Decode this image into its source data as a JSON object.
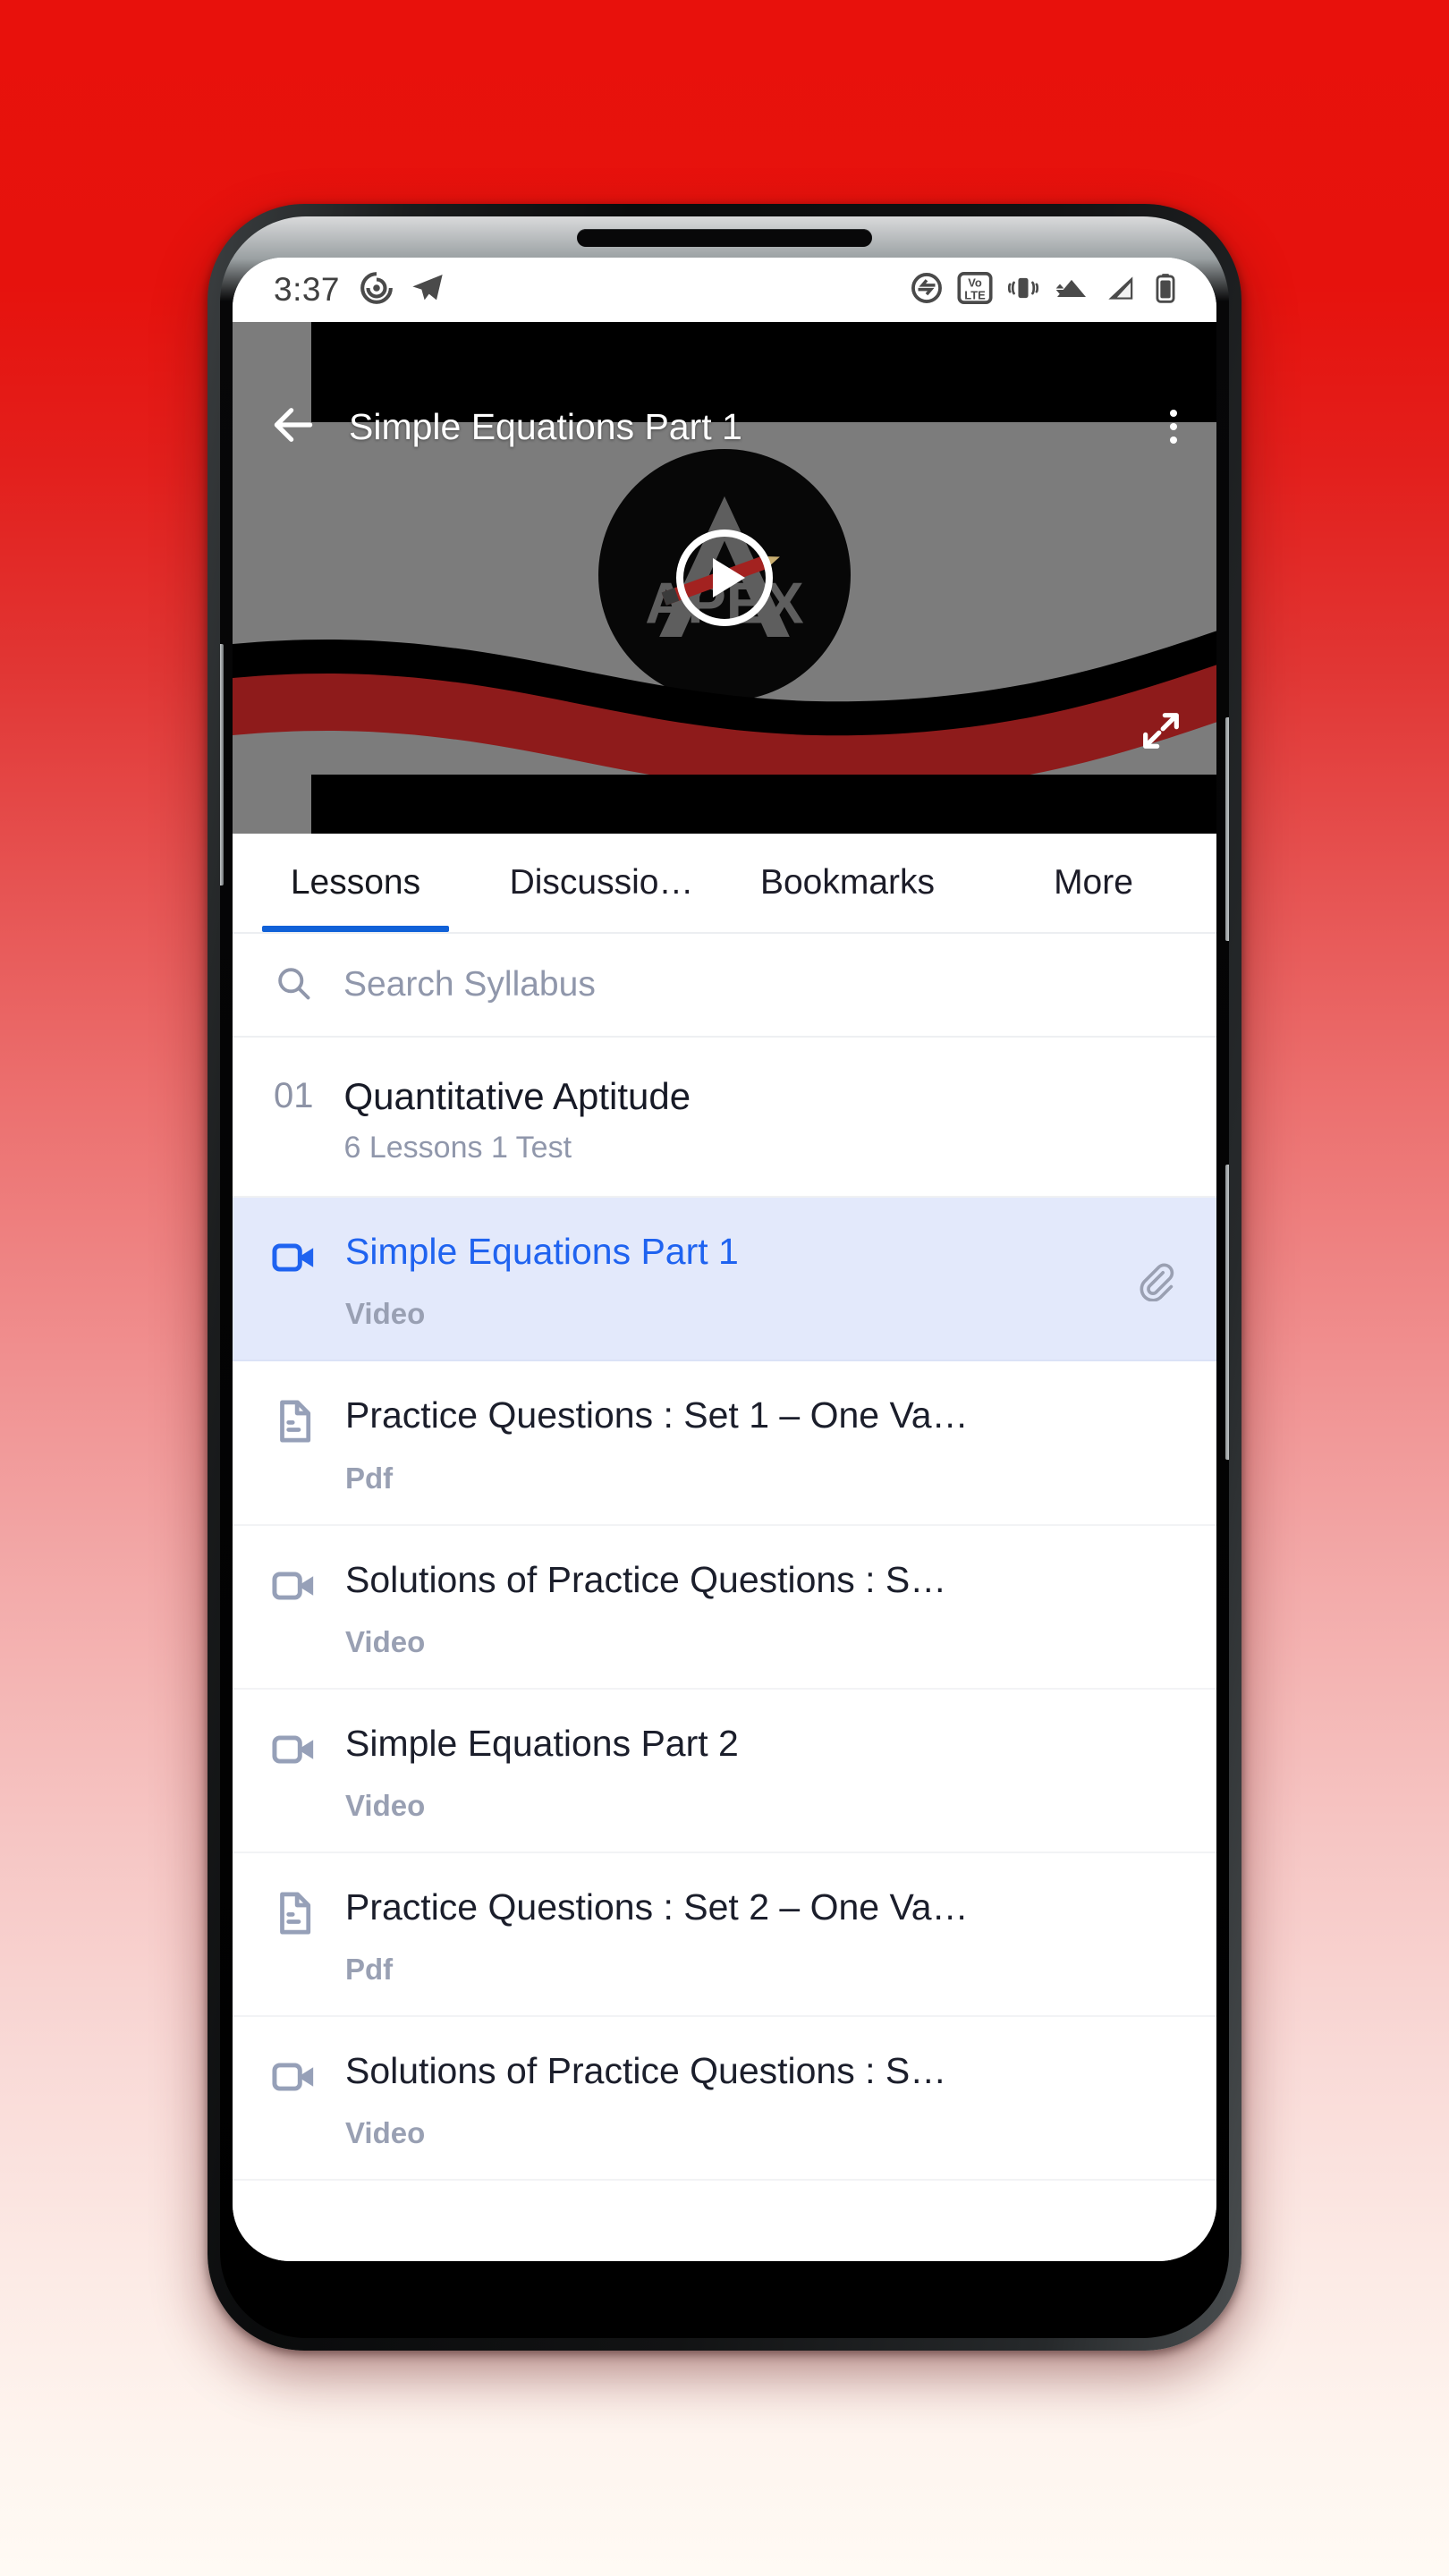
{
  "status_bar": {
    "time": "3:37",
    "left_icons": [
      "spiral-app-icon",
      "telegram-icon"
    ],
    "right_icons": [
      "data-saver-icon",
      "volte-icon",
      "vibrate-icon",
      "wifi-icon",
      "signal-icon",
      "battery-icon"
    ]
  },
  "player": {
    "title": "Simple Equations Part 1",
    "back_icon": "back-arrow-icon",
    "overflow_icon": "kebab-menu-icon",
    "play_icon": "play-icon",
    "expand_icon": "fullscreen-expand-icon",
    "logo_text": "APEX",
    "colors": {
      "backdrop": "#7c7c7c",
      "bars": "#000000",
      "wave_red": "#8E1B1B"
    }
  },
  "tabs": {
    "items": [
      {
        "label": "Lessons",
        "active": true
      },
      {
        "label": "Discussio…",
        "active": false
      },
      {
        "label": "Bookmarks",
        "active": false
      },
      {
        "label": "More",
        "active": false
      }
    ],
    "indicator_color": "#1061D8"
  },
  "search": {
    "icon": "search-icon",
    "placeholder": "Search Syllabus",
    "value": ""
  },
  "chapter": {
    "number": "01",
    "title": "Quantitative Aptitude",
    "meta": "6 Lessons  1 Test"
  },
  "lessons": [
    {
      "title": "Simple Equations Part 1",
      "type": "Video",
      "icon": "video-camera-icon",
      "selected": true,
      "trailing_icon": "paperclip-icon"
    },
    {
      "title": "Practice Questions : Set 1 – One Va…",
      "type": "Pdf",
      "icon": "document-icon",
      "selected": false,
      "trailing_icon": ""
    },
    {
      "title": "Solutions of Practice Questions : S…",
      "type": "Video",
      "icon": "video-camera-icon",
      "selected": false,
      "trailing_icon": ""
    },
    {
      "title": "Simple Equations Part 2",
      "type": "Video",
      "icon": "video-camera-icon",
      "selected": false,
      "trailing_icon": ""
    },
    {
      "title": "Practice Questions : Set 2 – One Va…",
      "type": "Pdf",
      "icon": "document-icon",
      "selected": false,
      "trailing_icon": ""
    },
    {
      "title": "Solutions of Practice Questions : S…",
      "type": "Video",
      "icon": "video-camera-icon",
      "selected": false,
      "trailing_icon": ""
    }
  ],
  "theme": {
    "accent_blue": "#1F63F0",
    "selected_row_bg": "#E3E9FB",
    "muted_text": "#9097ab",
    "background_top": "#E8110C",
    "background_bottom": "#FFFAF4"
  }
}
